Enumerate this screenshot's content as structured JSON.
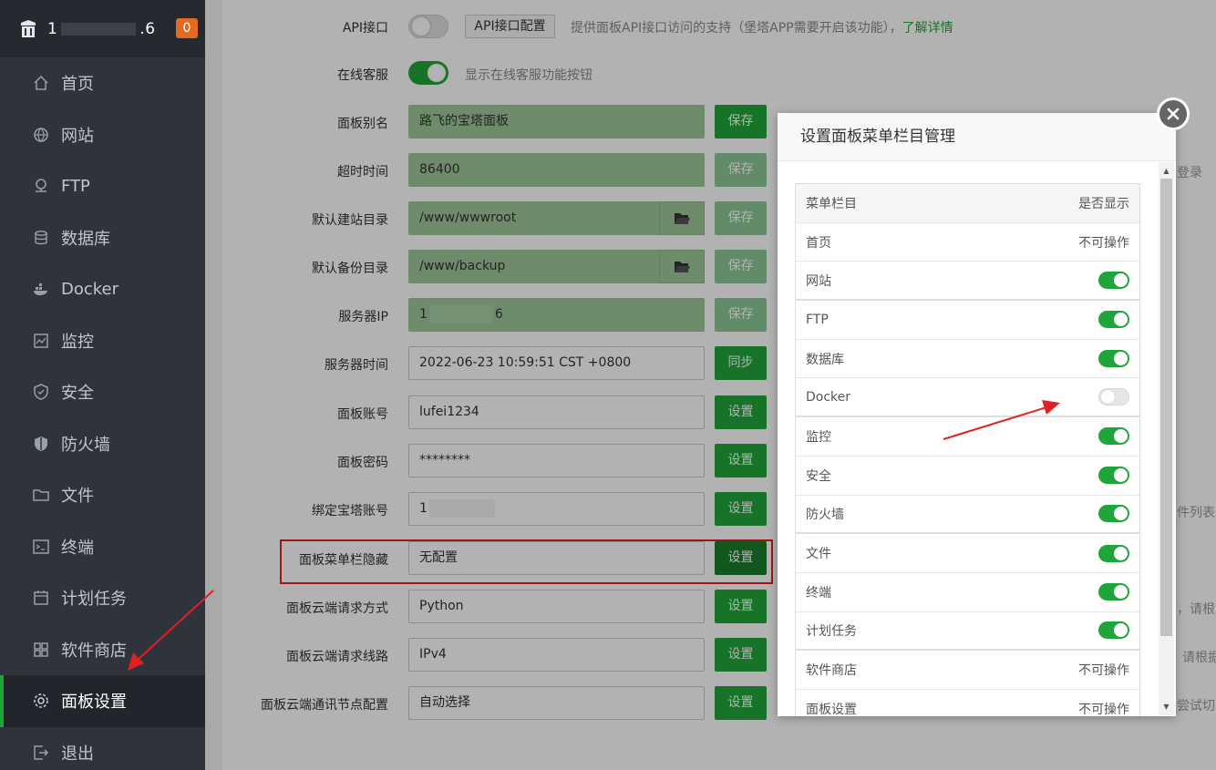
{
  "sidebar": {
    "ip_prefix": "1",
    "ip_suffix": ".6",
    "badge": "0",
    "items": [
      {
        "label": "首页",
        "icon": "home-icon"
      },
      {
        "label": "网站",
        "icon": "globe-icon"
      },
      {
        "label": "FTP",
        "icon": "ftp-icon"
      },
      {
        "label": "数据库",
        "icon": "database-icon"
      },
      {
        "label": "Docker",
        "icon": "docker-icon"
      },
      {
        "label": "监控",
        "icon": "monitor-icon"
      },
      {
        "label": "安全",
        "icon": "shield-icon"
      },
      {
        "label": "防火墙",
        "icon": "firewall-icon"
      },
      {
        "label": "文件",
        "icon": "folder-icon"
      },
      {
        "label": "终端",
        "icon": "terminal-icon"
      },
      {
        "label": "计划任务",
        "icon": "calendar-icon"
      },
      {
        "label": "软件商店",
        "icon": "grid-icon"
      },
      {
        "label": "面板设置",
        "icon": "gear-icon"
      },
      {
        "label": "退出",
        "icon": "logout-icon"
      }
    ]
  },
  "settings": {
    "api_label": "API接口",
    "api_config_btn": "API接口配置",
    "api_hint": "提供面板API接口访问的支持（堡塔APP需要开启该功能），",
    "api_hint_link": "了解详情",
    "online_service_label": "在线客服",
    "online_service_hint": "显示在线客服功能按钮",
    "rows": [
      {
        "label": "面板别名",
        "value": "路飞的宝塔面板",
        "btn": "保存"
      },
      {
        "label": "超时时间",
        "value": "86400",
        "btn": "保存"
      },
      {
        "label": "默认建站目录",
        "value": "/www/wwwroot",
        "btn": "保存"
      },
      {
        "label": "默认备份目录",
        "value": "/www/backup",
        "btn": "保存"
      },
      {
        "label": "服务器IP",
        "value_prefix": "1",
        "value_suffix": "6",
        "btn": "保存"
      },
      {
        "label": "服务器时间",
        "value": "2022-06-23 10:59:51 CST +0800",
        "btn": "同步"
      },
      {
        "label": "面板账号",
        "value": "lufei1234",
        "btn": "设置"
      },
      {
        "label": "面板密码",
        "value": "********",
        "btn": "设置"
      },
      {
        "label": "绑定宝塔账号",
        "value_prefix": "1",
        "value_suffix": "",
        "btn": "设置"
      },
      {
        "label": "面板菜单栏隐藏",
        "value": "无配置",
        "btn": "设置"
      },
      {
        "label": "面板云端请求方式",
        "value": "Python",
        "btn": "设置"
      },
      {
        "label": "面板云端请求线路",
        "value": "IPv4",
        "btn": "设置"
      },
      {
        "label": "面板云端通讯节点配置",
        "value": "自动选择",
        "btn": "设置"
      }
    ],
    "edge_texts": [
      "登录",
      "件列表",
      "，请根",
      "请根据",
      "尝试切"
    ]
  },
  "modal": {
    "title": "设置面板菜单栏目管理",
    "col_menu": "菜单栏目",
    "col_show": "是否显示",
    "not_operable": "不可操作",
    "rows": [
      {
        "name": "首页",
        "state": "na"
      },
      {
        "name": "网站",
        "state": "on"
      },
      {
        "name": "FTP",
        "state": "on"
      },
      {
        "name": "数据库",
        "state": "on"
      },
      {
        "name": "Docker",
        "state": "off"
      },
      {
        "name": "监控",
        "state": "on"
      },
      {
        "name": "安全",
        "state": "on"
      },
      {
        "name": "防火墙",
        "state": "on"
      },
      {
        "name": "文件",
        "state": "on"
      },
      {
        "name": "终端",
        "state": "on"
      },
      {
        "name": "计划任务",
        "state": "on"
      },
      {
        "name": "软件商店",
        "state": "na"
      },
      {
        "name": "面板设置",
        "state": "na"
      }
    ]
  },
  "colors": {
    "accent": "#20a53a",
    "sidebar_bg": "#2f333b",
    "annotation_red": "#e02020"
  }
}
